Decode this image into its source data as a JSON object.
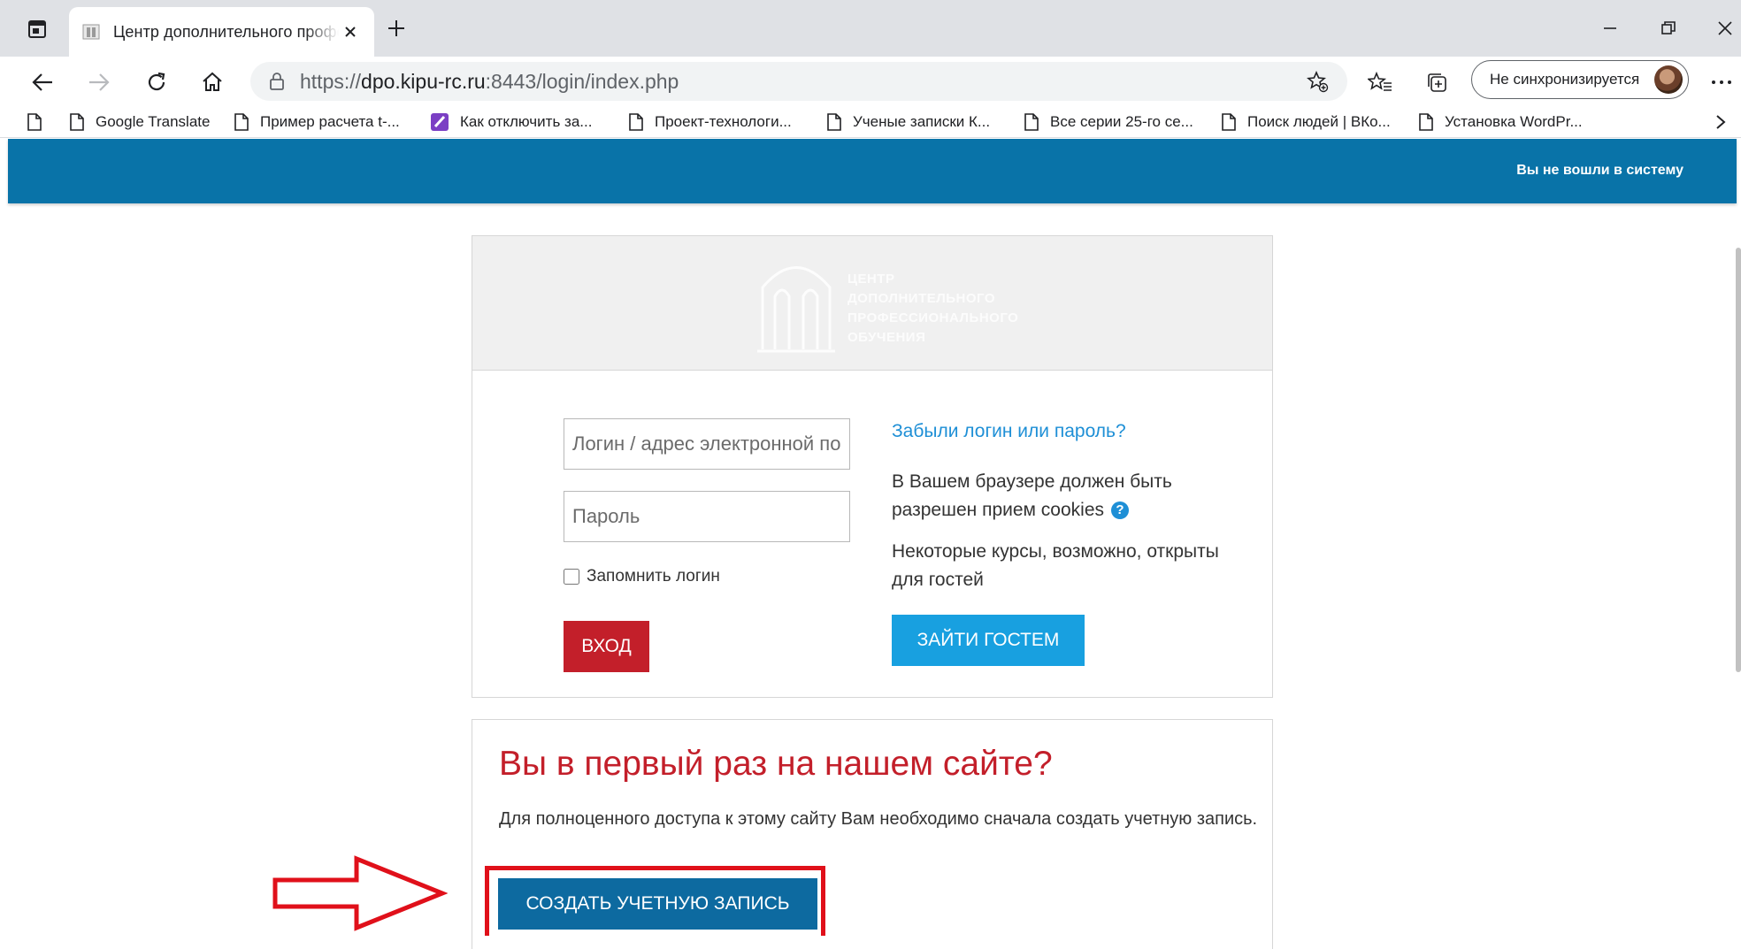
{
  "browser": {
    "tab": {
      "title": "Центр дополнительного профессионального"
    },
    "url": {
      "scheme": "https://",
      "host": "dpo.kipu-rc.ru",
      "rest": ":8443/login/index.php"
    },
    "profile": {
      "label": "Не синхронизируется"
    },
    "bookmarks": [
      {
        "label": "",
        "icon": "page-icon"
      },
      {
        "label": "Google Translate",
        "icon": "page-icon"
      },
      {
        "label": "Пример расчета t-...",
        "icon": "page-icon"
      },
      {
        "label": "Как отключить за...",
        "icon": "onenote-icon"
      },
      {
        "label": "Проект-технологи...",
        "icon": "page-icon"
      },
      {
        "label": "Ученые записки К...",
        "icon": "page-icon"
      },
      {
        "label": "Все серии 25-го се...",
        "icon": "page-icon"
      },
      {
        "label": "Поиск людей | ВКо...",
        "icon": "page-icon"
      },
      {
        "label": "Установка WordPr...",
        "icon": "page-icon"
      }
    ]
  },
  "header": {
    "login_status": "Вы не вошли в систему"
  },
  "login": {
    "logo_lines": [
      "ЦЕНТР",
      "ДОПОЛНИТЕЛЬНОГО",
      "ПРОФЕССИОНАЛЬНОГО",
      "ОБУЧЕНИЯ"
    ],
    "username_placeholder": "Логин / адрес электронной почты",
    "password_placeholder": "Пароль",
    "remember_label": "Запомнить логин",
    "submit_label": "Вход",
    "forgot_link": "Забыли логин или пароль?",
    "cookies_text": "В Вашем браузере должен быть разрешен прием cookies",
    "guest_text": "Некоторые курсы, возможно, открыты для гостей",
    "guest_button": "Зайти гостем"
  },
  "signup": {
    "title": "Вы в первый раз на нашем сайте?",
    "text": "Для полноценного доступа к этому сайту Вам необходимо сначала создать учетную запись.",
    "button": "Создать учетную запись"
  },
  "colors": {
    "header_bg": "#0973a8",
    "login_button": "#c31f2a",
    "guest_button": "#18a0e0",
    "create_button": "#0d6aa0",
    "annotation_red": "#e0101a",
    "link": "#1e8fd6"
  }
}
